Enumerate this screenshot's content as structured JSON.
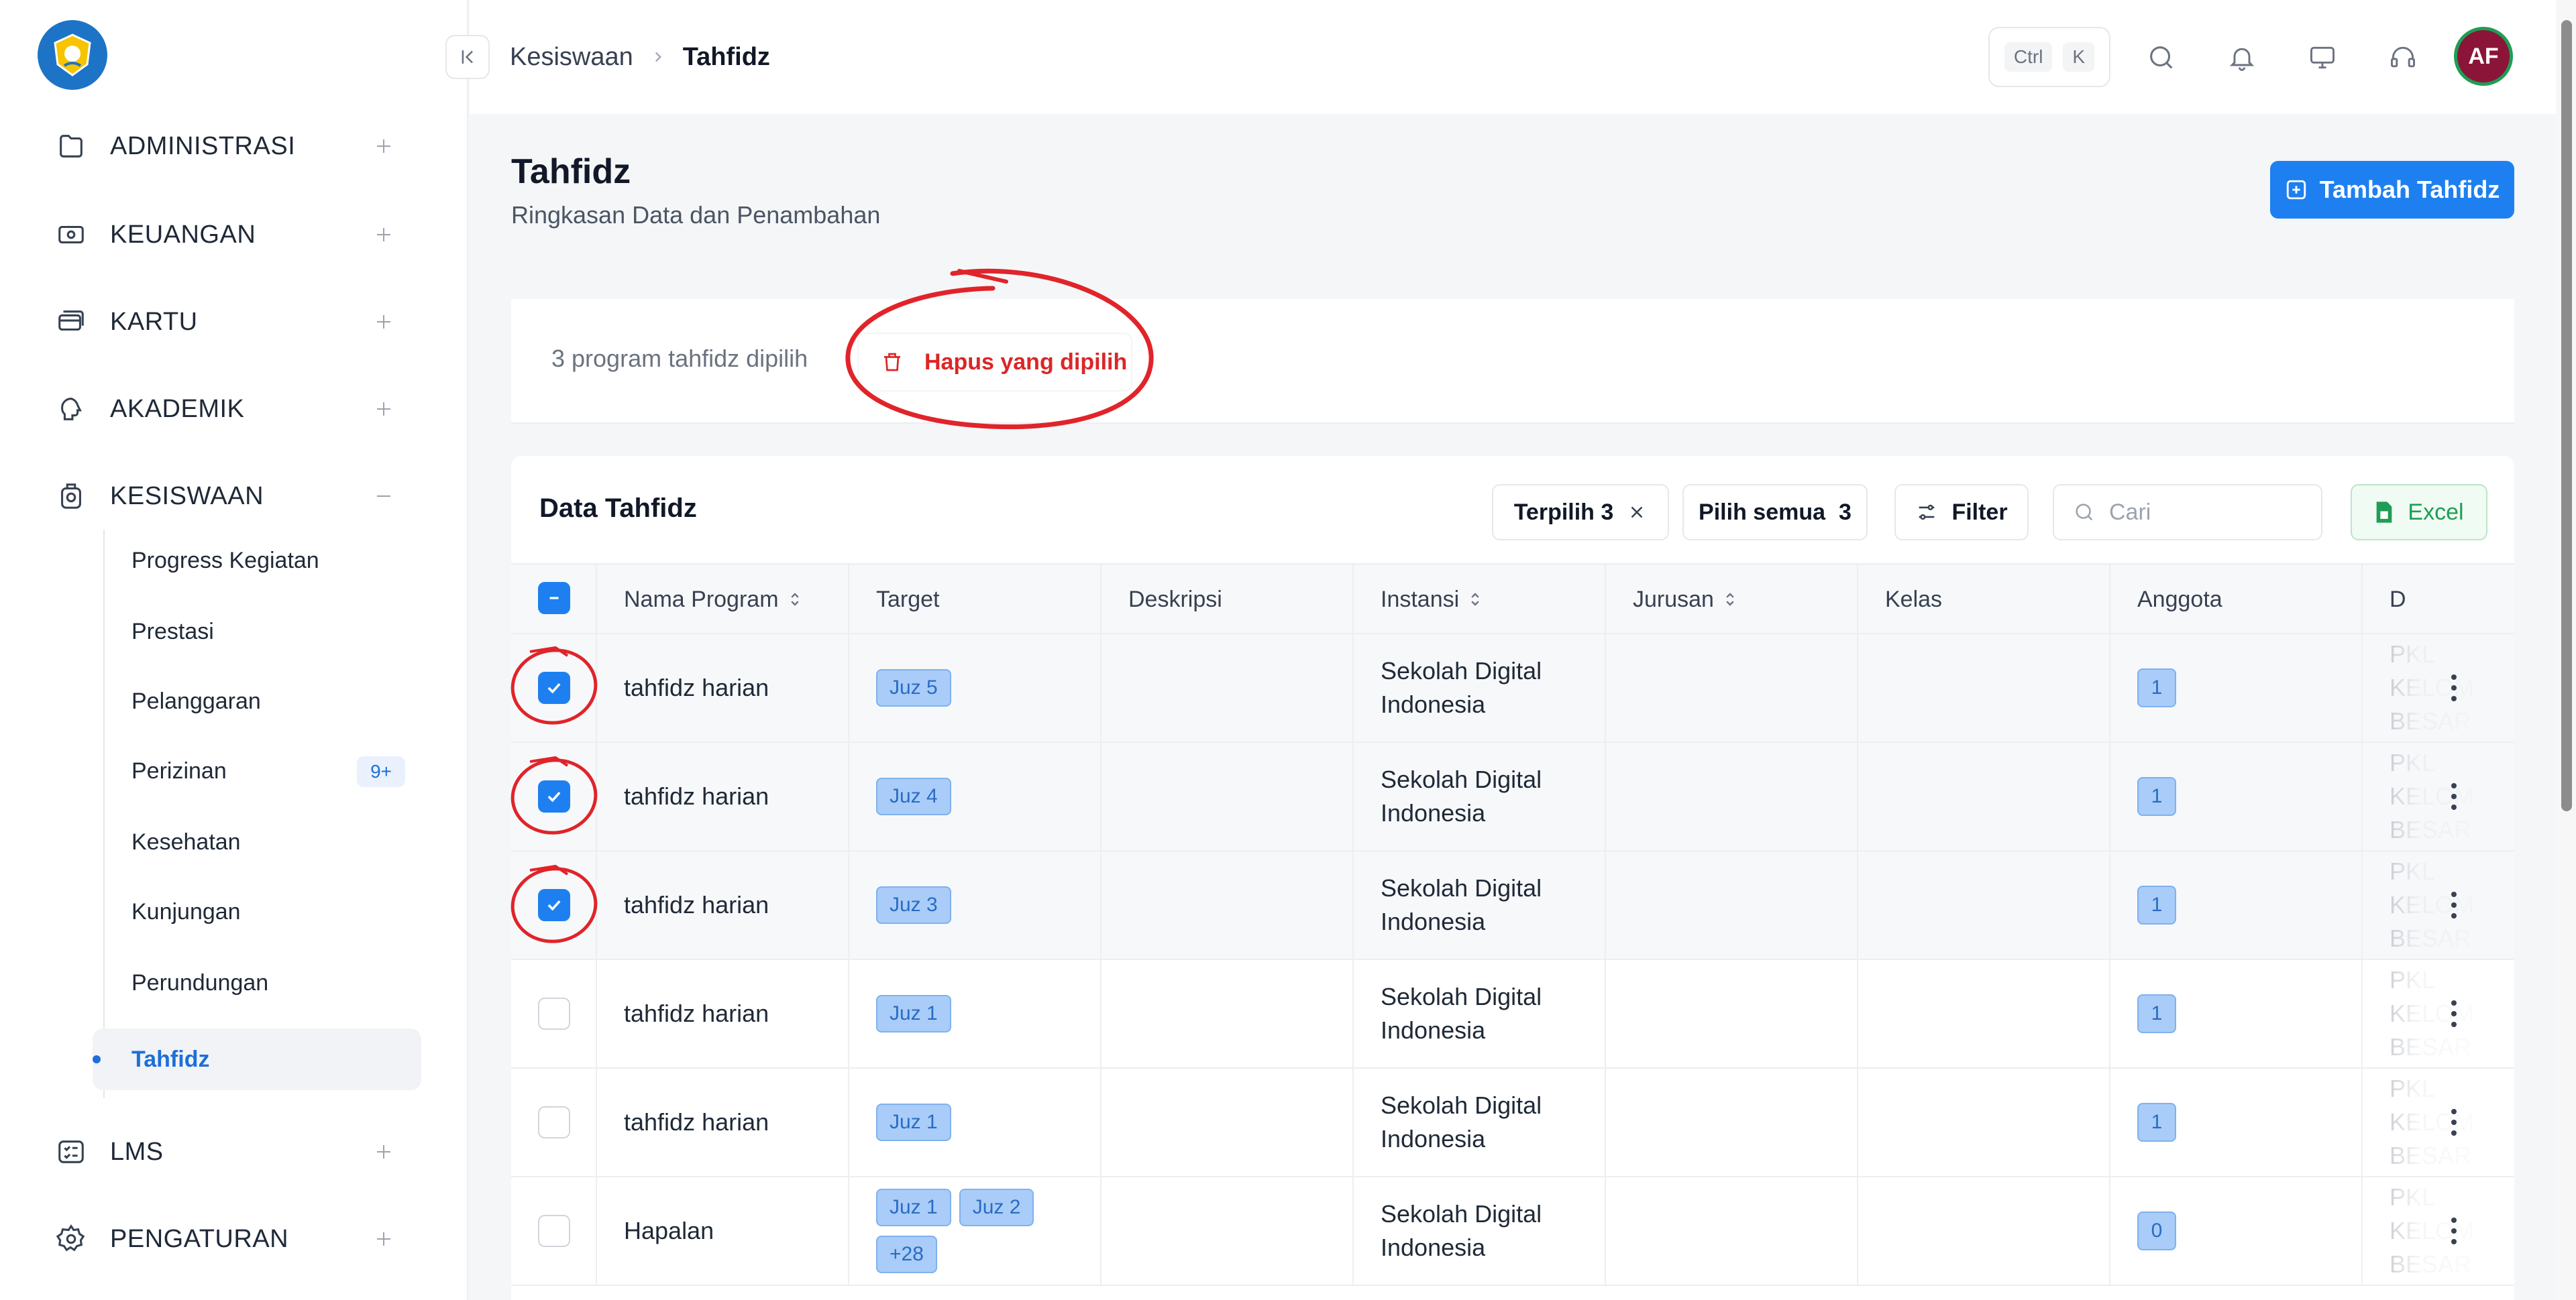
{
  "sidebar": {
    "items": [
      {
        "label": "ADMINISTRASI"
      },
      {
        "label": "KEUANGAN"
      },
      {
        "label": "KARTU"
      },
      {
        "label": "AKADEMIK"
      },
      {
        "label": "KESISWAAN"
      },
      {
        "label": "LMS"
      },
      {
        "label": "PENGATURAN"
      }
    ],
    "kesiswaan_sub": [
      {
        "label": "Progress Kegiatan"
      },
      {
        "label": "Prestasi"
      },
      {
        "label": "Pelanggaran"
      },
      {
        "label": "Perizinan",
        "badge": "9+"
      },
      {
        "label": "Kesehatan"
      },
      {
        "label": "Kunjungan"
      },
      {
        "label": "Perundungan"
      },
      {
        "label": "Tahfidz",
        "active": true
      }
    ]
  },
  "topbar": {
    "breadcrumb": {
      "parent": "Kesiswaan",
      "current": "Tahfidz"
    },
    "shortcut": {
      "key1": "Ctrl",
      "key2": "K"
    },
    "avatar_initials": "AF"
  },
  "page": {
    "title": "Tahfidz",
    "subtitle": "Ringkasan Data dan Penambahan",
    "add_button": "Tambah Tahfidz"
  },
  "selection": {
    "text": "3 program tahfidz dipilih",
    "delete_label": "Hapus yang dipilih"
  },
  "table": {
    "title": "Data Tahfidz",
    "chip_selected": "Terpilih 3",
    "chip_select_all": "Pilih semua",
    "chip_select_all_count": "3",
    "filter_label": "Filter",
    "search_placeholder": "Cari",
    "excel_label": "Excel",
    "columns": [
      "Nama Program",
      "Target",
      "Deskripsi",
      "Instansi",
      "Jurusan",
      "Kelas",
      "Anggota",
      "D"
    ],
    "rows": [
      {
        "name": "tahfidz harian",
        "targets": [
          "Juz 5"
        ],
        "instansi_1": "Sekolah Digital",
        "instansi_2": "Indonesia",
        "anggota": "1",
        "last_1": "PKL KELOM",
        "last_2": "BESAR",
        "checked": true
      },
      {
        "name": "tahfidz harian",
        "targets": [
          "Juz 4"
        ],
        "instansi_1": "Sekolah Digital",
        "instansi_2": "Indonesia",
        "anggota": "1",
        "last_1": "PKL KELOM",
        "last_2": "BESAR",
        "checked": true
      },
      {
        "name": "tahfidz harian",
        "targets": [
          "Juz 3"
        ],
        "instansi_1": "Sekolah Digital",
        "instansi_2": "Indonesia",
        "anggota": "1",
        "last_1": "PKL KELOM",
        "last_2": "BESAR",
        "checked": true
      },
      {
        "name": "tahfidz harian",
        "targets": [
          "Juz 1"
        ],
        "instansi_1": "Sekolah Digital",
        "instansi_2": "Indonesia",
        "anggota": "1",
        "last_1": "PKL KELOM",
        "last_2": "BESAR",
        "checked": false
      },
      {
        "name": "tahfidz harian",
        "targets": [
          "Juz 1"
        ],
        "instansi_1": "Sekolah Digital",
        "instansi_2": "Indonesia",
        "anggota": "1",
        "last_1": "PKL KELOM",
        "last_2": "BESAR",
        "checked": false
      },
      {
        "name": "Hapalan",
        "targets": [
          "Juz 1",
          "Juz 2",
          "+28"
        ],
        "instansi_1": "Sekolah Digital",
        "instansi_2": "Indonesia",
        "anggota": "0",
        "last_1": "PKL KELOM",
        "last_2": "BESAR",
        "checked": false
      }
    ]
  },
  "colors": {
    "accent": "#1e80f0",
    "danger": "#dc2626",
    "annotation": "#e0242a"
  }
}
